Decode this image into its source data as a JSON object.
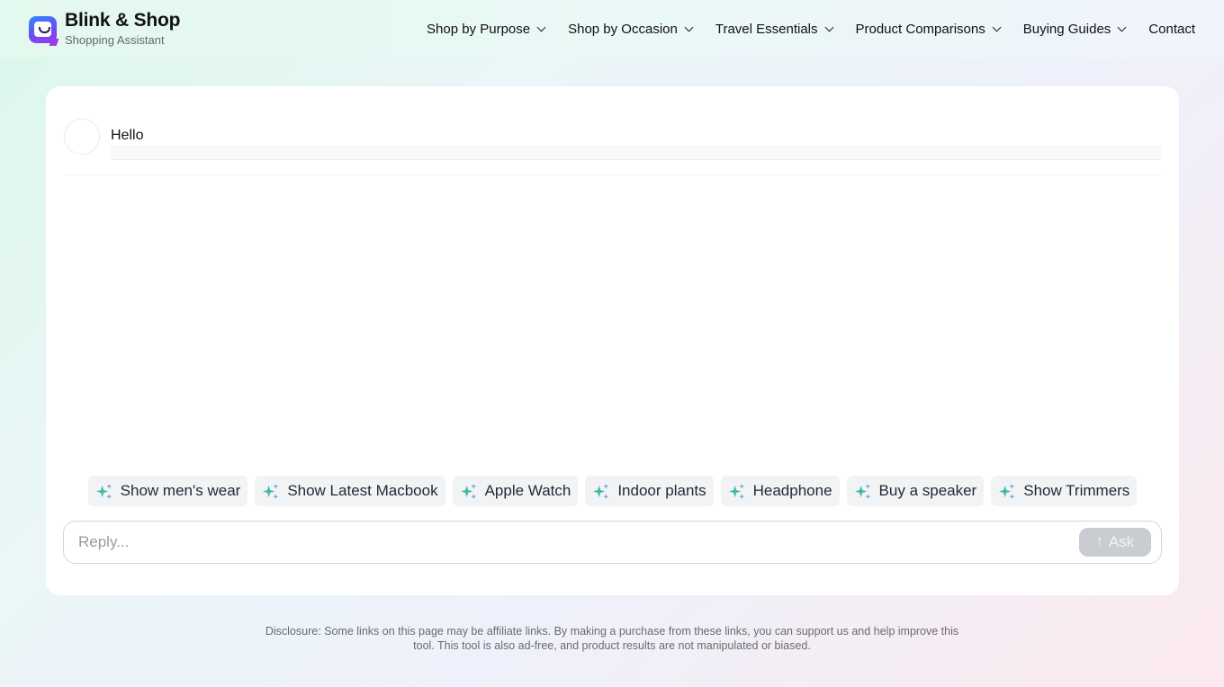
{
  "brand": {
    "title": "Blink & Shop",
    "subtitle": "Shopping Assistant",
    "logo_icon": "smiling-chat-bubble-logo"
  },
  "nav": {
    "items": [
      {
        "label": "Shop by Purpose",
        "has_dropdown": true
      },
      {
        "label": "Shop by Occasion",
        "has_dropdown": true
      },
      {
        "label": "Travel Essentials",
        "has_dropdown": true
      },
      {
        "label": "Product Comparisons",
        "has_dropdown": true
      },
      {
        "label": "Buying Guides",
        "has_dropdown": true
      },
      {
        "label": "Contact",
        "has_dropdown": false
      }
    ]
  },
  "chat": {
    "messages": [
      {
        "text": "Hello"
      }
    ]
  },
  "suggestions": {
    "icon": "sparkles-icon",
    "items": [
      {
        "label": "Show men's wear"
      },
      {
        "label": "Show Latest Macbook"
      },
      {
        "label": "Apple Watch"
      },
      {
        "label": "Indoor plants"
      },
      {
        "label": "Headphone"
      },
      {
        "label": "Buy a speaker"
      },
      {
        "label": "Show Trimmers"
      }
    ]
  },
  "composer": {
    "placeholder": "Reply...",
    "value": "",
    "ask_label": "Ask",
    "ask_icon": "arrow-up-icon"
  },
  "footer": {
    "disclosure": "Disclosure: Some links on this page may be affiliate links. By making a purchase from these links, you can support us and help improve this tool. This tool is also ad-free, and product results are not manipulated or biased."
  },
  "colors": {
    "sparkle_teal": "#3fb8a6",
    "sparkle_blue": "#6aa6d8",
    "chip_bg": "#f2f3f5",
    "ask_disabled_bg": "#c9ccd1"
  }
}
